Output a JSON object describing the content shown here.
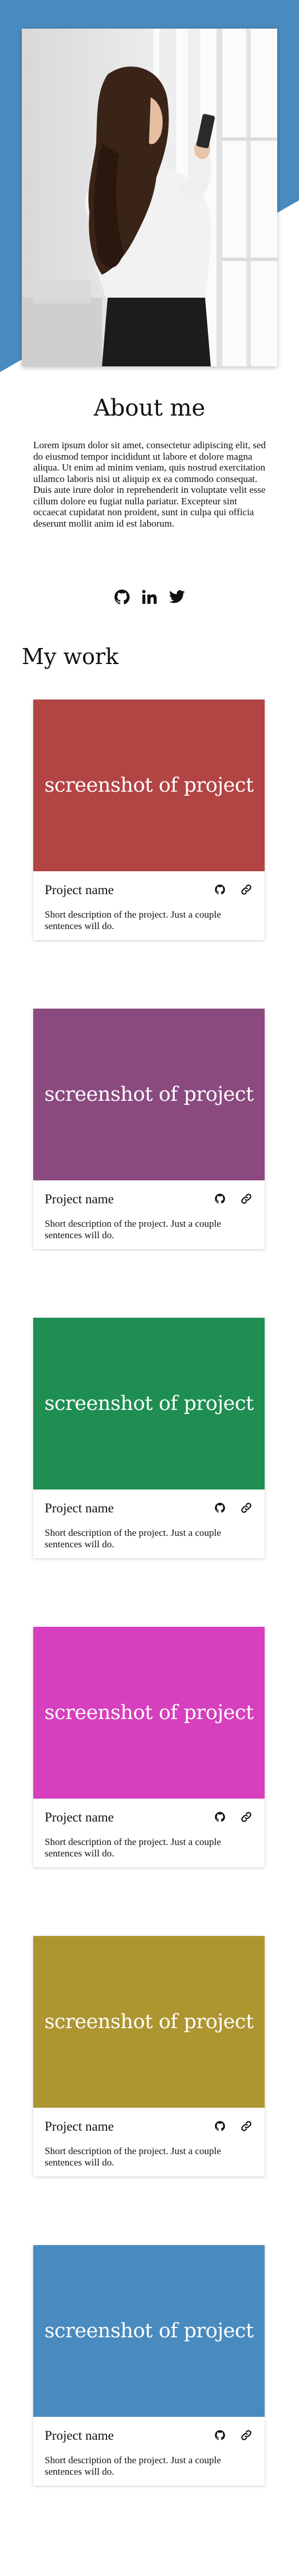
{
  "theme": {
    "accent": "#4a8bbf",
    "background": "#ffffff",
    "text": "#111111"
  },
  "about": {
    "title": "About me",
    "text": "Lorem ipsum dolor sit amet, consectetur adipiscing elit, sed do eiusmod tempor incididunt ut labore et dolore magna aliqua. Ut enim ad minim veniam, quis nostrud exercitation ullamco laboris nisi ut aliquip ex ea commodo consequat. Duis aute irure dolor in reprehenderit in voluptate velit esse cillum dolore eu fugiat nulla pariatur. Excepteur sint occaecat cupidatat non proident, sunt in culpa qui officia deserunt mollit anim id est laborum.",
    "social": [
      "github-icon",
      "linkedin-icon",
      "twitter-icon"
    ]
  },
  "work": {
    "title": "My work",
    "projects": [
      {
        "screenshot": "screenshot of project",
        "name": "Project name",
        "description": "Short description of the project. Just a couple sentences will do.",
        "color": "#b34444"
      },
      {
        "screenshot": "screenshot of project",
        "name": "Project name",
        "description": "Short description of the project. Just a couple sentences will do.",
        "color": "#8a4a80"
      },
      {
        "screenshot": "screenshot of project",
        "name": "Project name",
        "description": "Short description of the project. Just a couple sentences will do.",
        "color": "#1e8e52"
      },
      {
        "screenshot": "screenshot of project",
        "name": "Project name",
        "description": "Short description of the project. Just a couple sentences will do.",
        "color": "#d63fbd"
      },
      {
        "screenshot": "screenshot of project",
        "name": "Project name",
        "description": "Short description of the project. Just a couple sentences will do.",
        "color": "#ad9530"
      },
      {
        "screenshot": "screenshot of project",
        "name": "Project name",
        "description": "Short description of the project. Just a couple sentences will do.",
        "color": "#4a8bbf"
      }
    ]
  }
}
